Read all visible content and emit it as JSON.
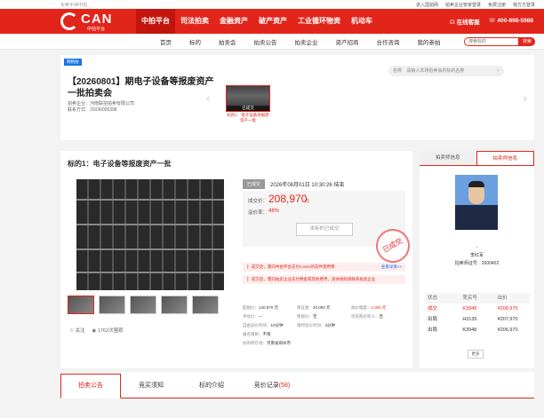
{
  "top": {
    "slogan": "买卖手续中拍",
    "links": [
      "进入国拍网",
      "拍卖企业管家登录",
      "免费注册",
      "我方方登录"
    ]
  },
  "header": {
    "logo_text": "CAN",
    "logo_sub": "中拍平台",
    "nav": [
      "中拍平台",
      "司法拍卖",
      "金融资产",
      "破产资产",
      "工业循环物资",
      "机动车"
    ],
    "online_service": "在线客服",
    "phone": "400-898-5988"
  },
  "subnav": {
    "items": [
      "首页",
      "标的",
      "拍卖会",
      "拍卖公告",
      "拍卖企业",
      "资产招商",
      "合作咨询",
      "我的参拍"
    ],
    "search_placeholder": "搜索标的",
    "search_button": "搜索"
  },
  "session": {
    "tag": "网络拍",
    "title": "【20260801】期电子设备等报废资产一批拍卖会",
    "company": "拍卖企业：河南联拍拍卖有限公司",
    "contact": "联系方式：15036005398",
    "search_label": "名称",
    "search_placeholder": "请输入本场拍卖会的标的名称",
    "thumb_status": "已成交",
    "thumb_caption": "标的1：电子设备等报废资产一批"
  },
  "lot": {
    "title": "标的1：电子设备等报废资产一批",
    "status": "已成交",
    "end_time": "2026年08月01日  10:30:26 结束",
    "price_label": "成交价：",
    "price": "208,970",
    "price_unit": "元",
    "premium_label": "溢价率：",
    "premium": "48%",
    "ended_button": "本标的已成交",
    "stamp": "已成交",
    "notice1": "成交后，需向中拍平台支付0.15%的软件使用费",
    "notice1_more": "查看详情>>",
    "notice2": "成交后，需向拍卖企业支付佣金或其他费用，具体规则请联系拍卖企业",
    "follow": "关注",
    "views": "1762次围观",
    "info": [
      [
        {
          "k": "起拍价：",
          "v": "140,970 元"
        },
        {
          "k": "保证金：",
          "v": "20,000 元"
        },
        {
          "k": "加价幅度：",
          "v": "1,000 元",
          "red": true
        }
      ],
      [
        {
          "k": "评估价：",
          "v": "—"
        },
        {
          "k": "保留价：",
          "v": "无"
        },
        {
          "k": "优先购买权人：",
          "v": "无"
        }
      ],
      [
        {
          "k": "自由竞价时间：",
          "v": "10分钟"
        },
        {
          "k": "限时竞价时间：",
          "v": "3分钟"
        },
        {
          "k": "",
          "v": ""
        }
      ],
      [
        {
          "k": "报名限制：",
          "v": "不限"
        },
        {
          "k": "",
          "v": ""
        },
        {
          "k": "",
          "v": ""
        }
      ],
      [
        {
          "k": "标的所在地：",
          "v": "河南省郑州市"
        },
        {
          "k": "",
          "v": ""
        },
        {
          "k": "",
          "v": ""
        }
      ]
    ]
  },
  "side": {
    "tab1": "拍卖师信息",
    "tab2": "拍卖师信息",
    "dash": "-",
    "auctioneer_name": "李红军",
    "auctioneer_cert": "拍卖师证号：2600402",
    "bid_headers": [
      "状态",
      "竞买号",
      "出价"
    ],
    "bids": [
      {
        "status": "成交",
        "no": "K3948",
        "price": "¥208,970"
      },
      {
        "status": "出局",
        "no": "H3135",
        "price": "¥207,970"
      },
      {
        "status": "出局",
        "no": "K3948",
        "price": "¥206,970"
      }
    ],
    "more": "更多"
  },
  "bottom_tabs": {
    "t1": "拍卖公告",
    "t2": "竞买须知",
    "t3": "标的介绍",
    "t4": "竞价记录",
    "t4_count": "(58)"
  },
  "colors": {
    "brand": "#e1251b",
    "link": "#1a73e8"
  }
}
